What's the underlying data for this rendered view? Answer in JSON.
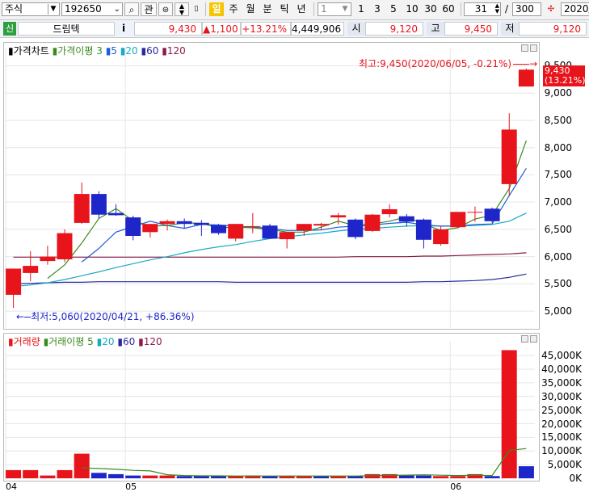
{
  "toolbar": {
    "market": "주식",
    "code": "192650",
    "btn_search": "⌕",
    "btn_watch": "관",
    "period_selected": "일",
    "periods": [
      "주",
      "월",
      "분",
      "틱",
      "년"
    ],
    "interval_value": "1",
    "intervals": [
      "1",
      "3",
      "5",
      "10",
      "30",
      "60"
    ],
    "count_value": "31",
    "total_value": "300",
    "date_value": "2020/"
  },
  "info": {
    "badge": "신",
    "name": "드림텍",
    "info_icon": "i",
    "price": "9,430",
    "change": "▲1,100",
    "change_pct": "+13.21%",
    "volume": "4,449,906",
    "open_label": "시",
    "open": "9,120",
    "high_label": "고",
    "high": "9,450",
    "low_label": "저",
    "low": "9,120"
  },
  "price_legend": {
    "title": "가격차트",
    "ma_label": "가격이평",
    "ma3": "3",
    "ma5": "5",
    "ma20": "20",
    "ma60": "60",
    "ma120": "120"
  },
  "volume_legend": {
    "title": "거래량",
    "ma_label": "거래이평",
    "ma5": "5",
    "ma20": "20",
    "ma60": "60",
    "ma120": "120"
  },
  "annotations": {
    "high": "최고:9,450(2020/06/05, -0.21%)",
    "low": "최저:5,060(2020/04/21, +86.36%)",
    "last_price": "9,430",
    "last_pct": "(13.21%)"
  },
  "colors": {
    "up": "#e8141b",
    "down": "#1f26c9",
    "ma3": "#3a8a1f",
    "ma5": "#1f5ed8",
    "ma20": "#18a9c4",
    "ma60": "#2a2aa0",
    "ma120": "#8a1a4a"
  },
  "chart_data": [
    {
      "type": "candlestick",
      "title": "가격차트",
      "x_ticks": [
        "04",
        "05",
        "06"
      ],
      "yticks": [
        "5,000",
        "5,500",
        "6,000",
        "6,500",
        "7,000",
        "7,500",
        "8,000",
        "8,500",
        "9,000",
        "9,500"
      ],
      "ylim": [
        4750,
        9700
      ],
      "candles": [
        {
          "o": 5300,
          "h": 5600,
          "l": 5060,
          "c": 5780
        },
        {
          "o": 5700,
          "h": 6100,
          "l": 5550,
          "c": 5830
        },
        {
          "o": 5920,
          "h": 6200,
          "l": 5850,
          "c": 6000
        },
        {
          "o": 5950,
          "h": 6500,
          "l": 5900,
          "c": 6430
        },
        {
          "o": 6620,
          "h": 7360,
          "l": 6600,
          "c": 7150
        },
        {
          "o": 7150,
          "h": 7200,
          "l": 6700,
          "c": 6770
        },
        {
          "o": 6800,
          "h": 6960,
          "l": 6750,
          "c": 6760
        },
        {
          "o": 6720,
          "h": 6750,
          "l": 6300,
          "c": 6380
        },
        {
          "o": 6450,
          "h": 6600,
          "l": 6350,
          "c": 6600
        },
        {
          "o": 6600,
          "h": 6680,
          "l": 6480,
          "c": 6650
        },
        {
          "o": 6650,
          "h": 6700,
          "l": 6520,
          "c": 6600
        },
        {
          "o": 6620,
          "h": 6670,
          "l": 6380,
          "c": 6580
        },
        {
          "o": 6580,
          "h": 6600,
          "l": 6400,
          "c": 6430
        },
        {
          "o": 6330,
          "h": 6600,
          "l": 6280,
          "c": 6600
        },
        {
          "o": 6560,
          "h": 6800,
          "l": 6430,
          "c": 6560
        },
        {
          "o": 6570,
          "h": 6600,
          "l": 6330,
          "c": 6330
        },
        {
          "o": 6320,
          "h": 6450,
          "l": 6150,
          "c": 6450
        },
        {
          "o": 6480,
          "h": 6600,
          "l": 6380,
          "c": 6600
        },
        {
          "o": 6570,
          "h": 6620,
          "l": 6500,
          "c": 6600
        },
        {
          "o": 6720,
          "h": 6800,
          "l": 6590,
          "c": 6760
        },
        {
          "o": 6680,
          "h": 6700,
          "l": 6320,
          "c": 6360
        },
        {
          "o": 6470,
          "h": 6780,
          "l": 6450,
          "c": 6770
        },
        {
          "o": 6780,
          "h": 6960,
          "l": 6720,
          "c": 6870
        },
        {
          "o": 6740,
          "h": 6780,
          "l": 6550,
          "c": 6640
        },
        {
          "o": 6680,
          "h": 6700,
          "l": 6150,
          "c": 6310
        },
        {
          "o": 6230,
          "h": 6560,
          "l": 6200,
          "c": 6500
        },
        {
          "o": 6540,
          "h": 6810,
          "l": 6530,
          "c": 6820
        },
        {
          "o": 6820,
          "h": 6920,
          "l": 6640,
          "c": 6820
        },
        {
          "o": 6880,
          "h": 6900,
          "l": 6620,
          "c": 6650
        },
        {
          "o": 7330,
          "h": 8630,
          "l": 7110,
          "c": 8330
        },
        {
          "o": 9120,
          "h": 9450,
          "l": 9120,
          "c": 9430
        }
      ],
      "ma3": [
        null,
        null,
        5600,
        5850,
        6250,
        6700,
        6880,
        6660,
        6560,
        6570,
        6620,
        6610,
        6530,
        6540,
        6530,
        6500,
        6450,
        6450,
        6540,
        6650,
        6570,
        6600,
        6650,
        6730,
        6600,
        6480,
        6530,
        6690,
        6760,
        7250,
        8130
      ],
      "ma5": [
        null,
        null,
        null,
        null,
        5900,
        6150,
        6450,
        6550,
        6650,
        6570,
        6520,
        6590,
        6580,
        6560,
        6540,
        6520,
        6480,
        6480,
        6490,
        6540,
        6560,
        6580,
        6610,
        6630,
        6580,
        6560,
        6560,
        6590,
        6600,
        7120,
        7620
      ],
      "ma20": [
        5450,
        5480,
        5520,
        5580,
        5650,
        5720,
        5800,
        5870,
        5940,
        6000,
        6070,
        6130,
        6180,
        6220,
        6280,
        6330,
        6360,
        6400,
        6430,
        6470,
        6500,
        6520,
        6540,
        6560,
        6570,
        6560,
        6560,
        6570,
        6590,
        6650,
        6800
      ],
      "ma60": [
        5500,
        5510,
        5520,
        5530,
        5530,
        5540,
        5540,
        5540,
        5540,
        5540,
        5540,
        5540,
        5540,
        5530,
        5530,
        5530,
        5530,
        5530,
        5530,
        5530,
        5530,
        5530,
        5530,
        5530,
        5540,
        5540,
        5550,
        5560,
        5580,
        5620,
        5680
      ],
      "ma120": [
        5990,
        5990,
        5990,
        5990,
        5990,
        5990,
        5990,
        5990,
        5990,
        5990,
        5990,
        5990,
        5990,
        5990,
        5990,
        5990,
        5990,
        5990,
        5990,
        5990,
        6000,
        6000,
        6000,
        6000,
        6010,
        6010,
        6020,
        6030,
        6040,
        6050,
        6070
      ]
    },
    {
      "type": "bar",
      "title": "거래량",
      "x_ticks": [
        "04",
        "05",
        "06"
      ],
      "yticks": [
        "0K",
        "5,000K",
        "10,000K",
        "15,000K",
        "20,000K",
        "25,000K",
        "30,000K",
        "35,000K",
        "40,000K",
        "45,000K"
      ],
      "ylim": [
        0,
        48000
      ],
      "values": [
        3000,
        3000,
        1000,
        3000,
        9000,
        2000,
        1500,
        1000,
        1000,
        1000,
        800,
        800,
        800,
        800,
        1000,
        800,
        800,
        800,
        800,
        800,
        800,
        1500,
        1500,
        1000,
        1000,
        800,
        800,
        1500,
        800,
        47000,
        4400
      ],
      "up": [
        true,
        true,
        true,
        true,
        true,
        false,
        false,
        false,
        true,
        true,
        false,
        false,
        false,
        true,
        true,
        false,
        true,
        true,
        false,
        true,
        false,
        true,
        true,
        false,
        false,
        true,
        true,
        true,
        false,
        true,
        false
      ],
      "ma5": [
        null,
        null,
        null,
        null,
        3800,
        3600,
        3300,
        2900,
        2700,
        1300,
        1000,
        900,
        880,
        840,
        840,
        840,
        840,
        840,
        840,
        840,
        840,
        940,
        1080,
        1160,
        1260,
        1120,
        1020,
        1100,
        1000,
        10200,
        10900
      ]
    }
  ]
}
